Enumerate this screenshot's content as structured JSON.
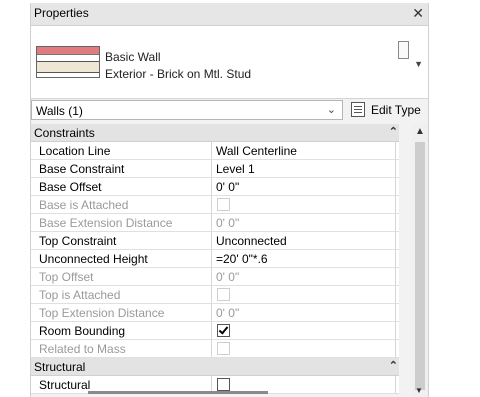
{
  "panel": {
    "title": "Properties",
    "close_glyph": "✕"
  },
  "type_selector": {
    "family": "Basic Wall",
    "type": "Exterior - Brick on Mtl. Stud",
    "swatch_colors": [
      "#e07c80",
      "#ffffff",
      "#f0e6d6"
    ]
  },
  "instance_filter": {
    "value": "Walls (1)"
  },
  "edit_type": {
    "label": "Edit Type"
  },
  "sections": [
    {
      "name": "Constraints",
      "rows": [
        {
          "label": "Location Line",
          "value": "Wall Centerline",
          "enabled": true,
          "kind": "text"
        },
        {
          "label": "Base Constraint",
          "value": "Level 1",
          "enabled": true,
          "kind": "text"
        },
        {
          "label": "Base Offset",
          "value": "0'  0\"",
          "enabled": true,
          "kind": "text"
        },
        {
          "label": "Base is Attached",
          "value": "",
          "enabled": false,
          "kind": "checkbox",
          "checked": false
        },
        {
          "label": "Base Extension Distance",
          "value": "0'  0\"",
          "enabled": false,
          "kind": "text"
        },
        {
          "label": "Top Constraint",
          "value": "Unconnected",
          "enabled": true,
          "kind": "text"
        },
        {
          "label": "Unconnected Height",
          "value": "=20'  0\"*.6",
          "enabled": true,
          "kind": "text"
        },
        {
          "label": "Top Offset",
          "value": "0'  0\"",
          "enabled": false,
          "kind": "text"
        },
        {
          "label": "Top is Attached",
          "value": "",
          "enabled": false,
          "kind": "checkbox",
          "checked": false
        },
        {
          "label": "Top Extension Distance",
          "value": "0'  0\"",
          "enabled": false,
          "kind": "text"
        },
        {
          "label": "Room Bounding",
          "value": "",
          "enabled": true,
          "kind": "checkbox",
          "checked": true
        },
        {
          "label": "Related to Mass",
          "value": "",
          "enabled": false,
          "kind": "checkbox",
          "checked": false
        }
      ]
    },
    {
      "name": "Structural",
      "rows": [
        {
          "label": "Structural",
          "value": "",
          "enabled": true,
          "kind": "checkbox",
          "checked": false
        }
      ]
    }
  ]
}
